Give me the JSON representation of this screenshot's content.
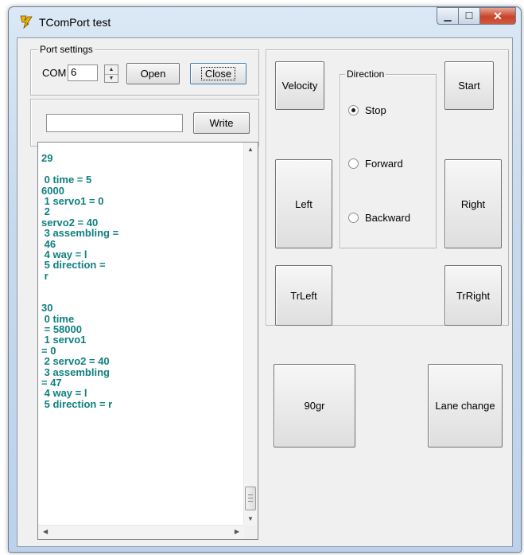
{
  "window": {
    "title": "TComPort test"
  },
  "port_settings": {
    "legend": "Port settings",
    "com_label": "COM",
    "com_value": "6",
    "open_label": "Open",
    "close_label": "Close"
  },
  "write": {
    "input_value": "",
    "button_label": "Write"
  },
  "log": {
    "text": "\n29\n\n 0 time = 5\n6000\n 1 servo1 = 0\n 2\nservo2 = 40\n 3 assembling =\n 46\n 4 way = l\n 5 direction =\n r\n\n\n30\n 0 time\n = 58000\n 1 servo1\n= 0\n 2 servo2 = 40\n 3 assembling\n= 47\n 4 way = l\n 5 direction = r"
  },
  "controls": {
    "velocity_label": "Velocity",
    "start_label": "Start",
    "left_label": "Left",
    "right_label": "Right",
    "trleft_label": "TrLeft",
    "trright_label": "TrRight",
    "direction": {
      "legend": "Direction",
      "options": [
        "Stop",
        "Forward",
        "Backward"
      ],
      "selected": "Stop"
    }
  },
  "bottom": {
    "turn90_label": "90gr",
    "lane_change_label": "Lane change"
  }
}
